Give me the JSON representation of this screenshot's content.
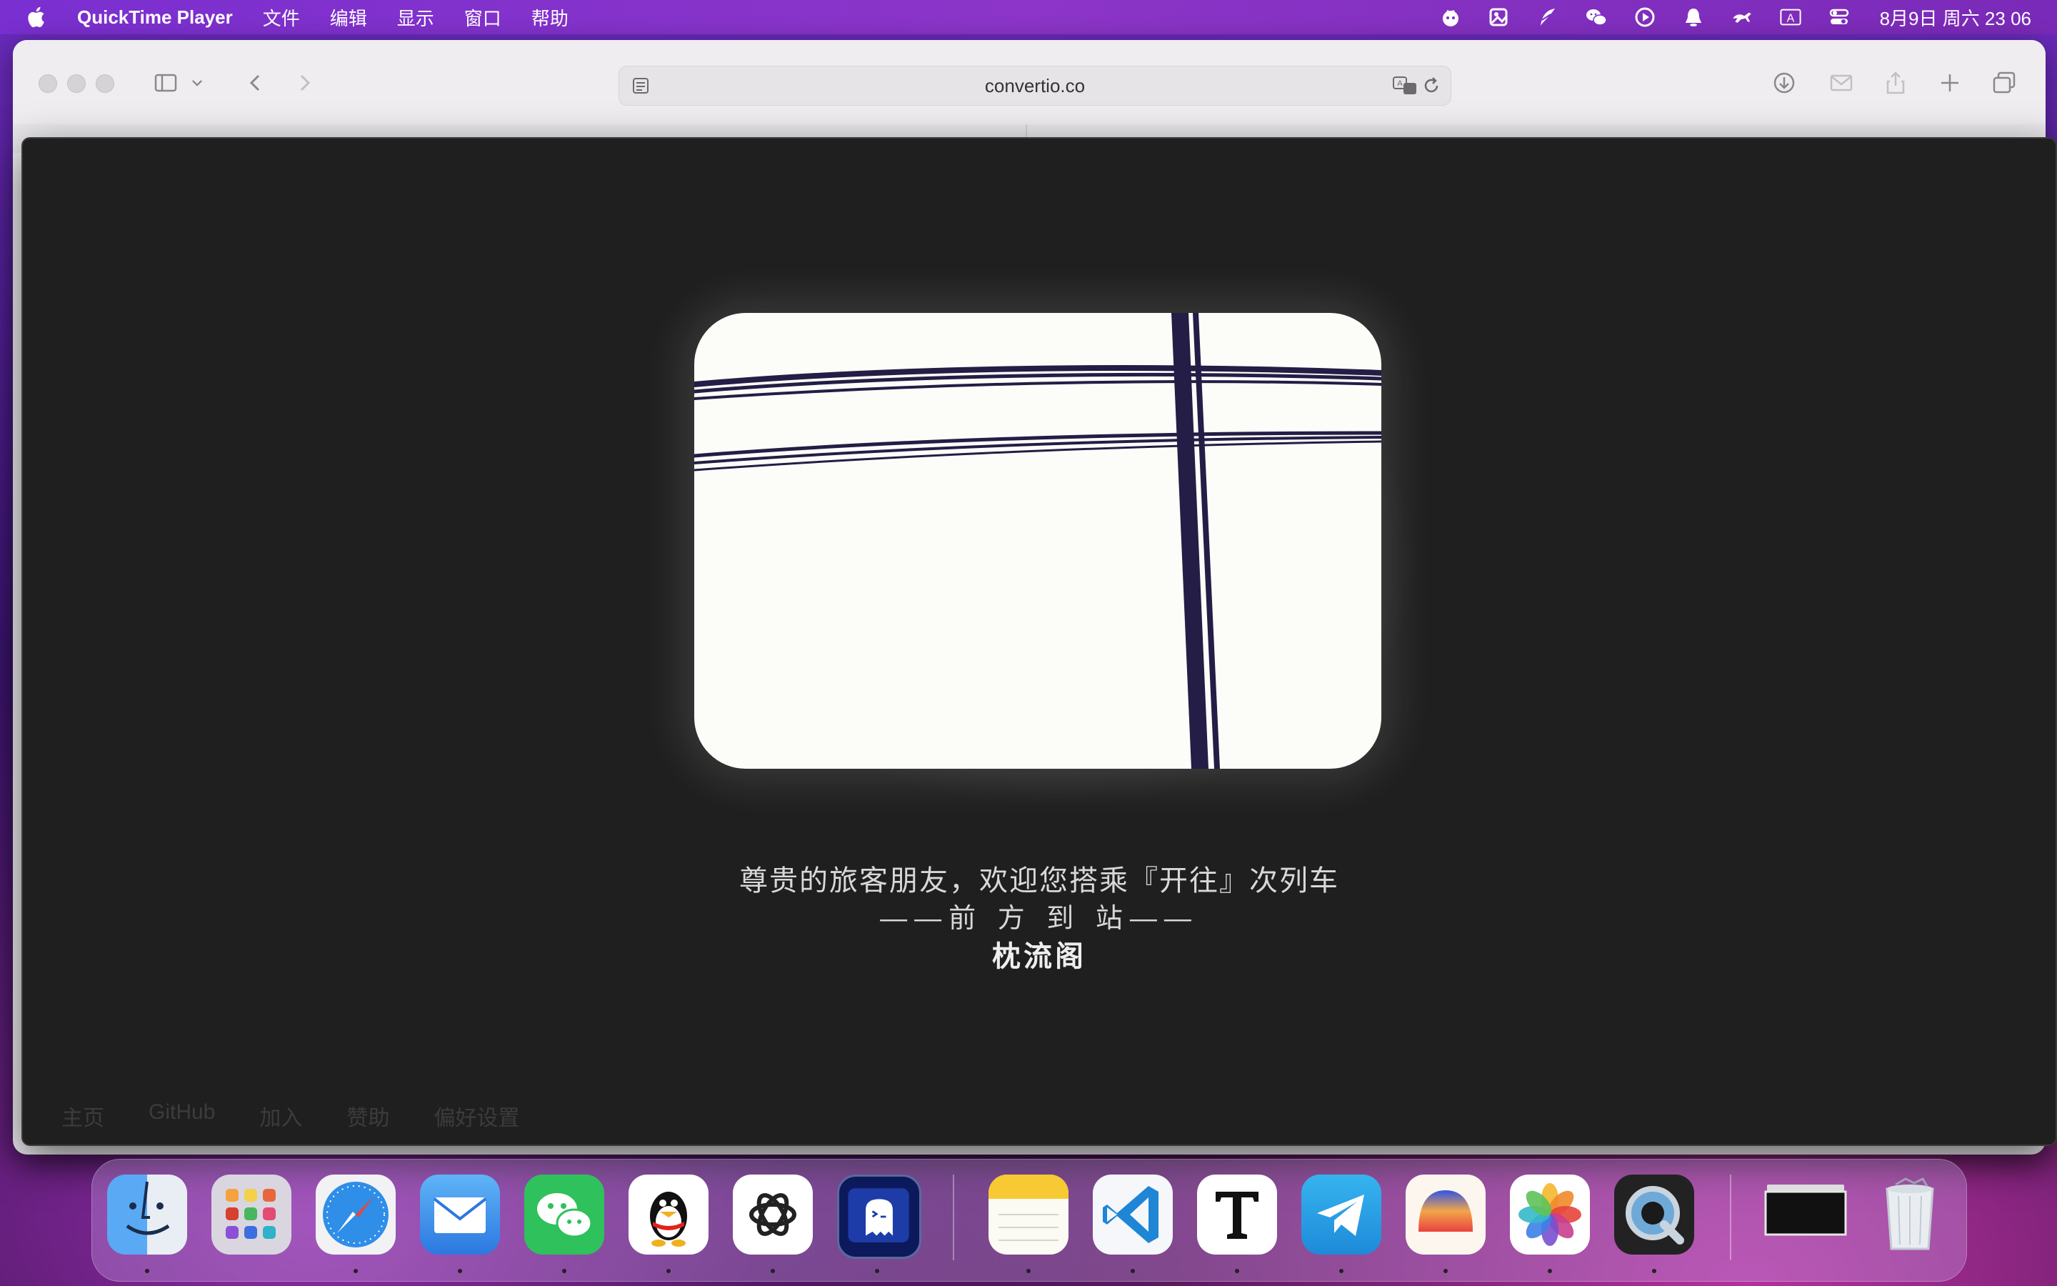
{
  "menubar": {
    "app_name": "QuickTime Player",
    "menus": [
      "文件",
      "编辑",
      "显示",
      "窗口",
      "帮助"
    ],
    "status_icons": [
      "tomato-timer-icon",
      "image-tool-icon",
      "feather-icon",
      "wechat-icon",
      "play-circle-icon",
      "qq-bell-icon",
      "running-animal-icon",
      "input-source-icon",
      "control-center-icon"
    ],
    "input_source_label": "A",
    "clock": "8月9日 周六  23 06"
  },
  "safari": {
    "url": "convertio.co"
  },
  "player": {
    "caption_line1": "尊贵的旅客朋友，欢迎您搭乘『开往』次列车",
    "caption_line2": "——前 方 到 站——",
    "station_name": "枕流阁",
    "nav_links": [
      "主页",
      "GitHub",
      "加入",
      "赞助",
      "偏好设置"
    ]
  },
  "dock": {
    "apps": [
      "Finder",
      "Launchpad",
      "Safari",
      "Mail",
      "WeChat",
      "QQ",
      "ChatGPT",
      "Ghostty",
      "Notes",
      "Visual Studio Code",
      "Typora",
      "Telegram",
      "Arc",
      "Photos",
      "QuickTime Player",
      "Window Preview",
      "Trash"
    ],
    "running": [
      "Finder",
      "Safari",
      "Mail",
      "WeChat",
      "QQ",
      "ChatGPT",
      "Ghostty",
      "Notes",
      "Visual Studio Code",
      "Typora",
      "Telegram",
      "Arc",
      "Photos",
      "QuickTime Player"
    ]
  },
  "colors": {
    "menubar": "#7a2fd0",
    "player_bg": "#1f1f1f",
    "wire": "#241d45",
    "window_bg": "#fcfcf8"
  }
}
